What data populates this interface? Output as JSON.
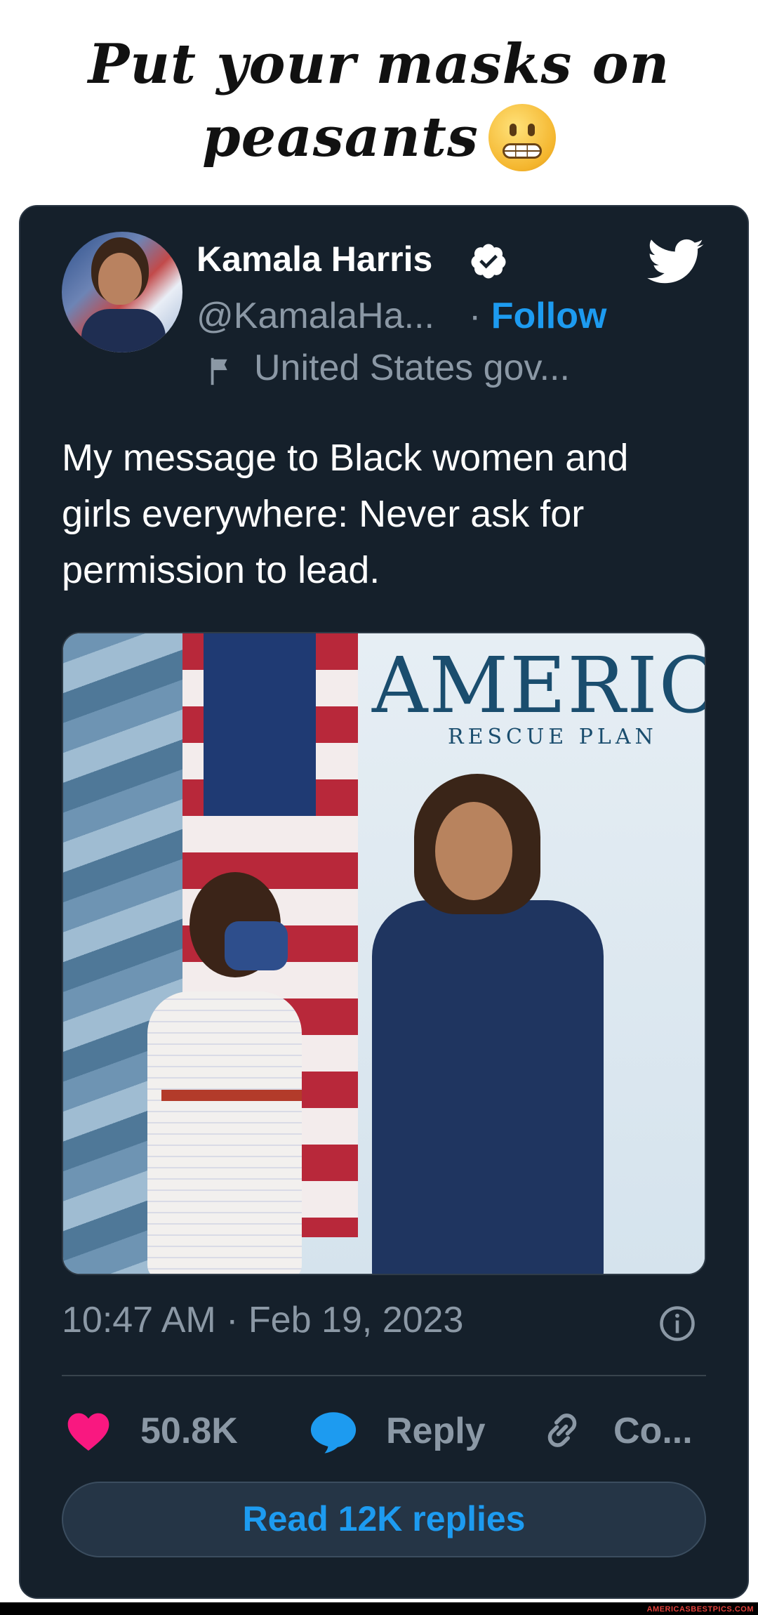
{
  "caption": {
    "line1": "Put your masks on",
    "line2": "peasants",
    "emoji": "grimacing-face"
  },
  "tweet": {
    "author_name": "Kamala Harris",
    "verified": true,
    "handle": "@KamalaHa...",
    "follow_separator": "·",
    "follow_label": "Follow",
    "affiliation": "United States gov...",
    "text": "My message to Black women and girls everywhere: Never ask for permission to lead.",
    "photo": {
      "banner_title": "AMERICAN",
      "banner_subtitle": "RESCUE PLAN"
    },
    "timestamp": "10:47 AM · Feb 19, 2023",
    "likes": "50.8K",
    "reply_label": "Reply",
    "copy_label": "Co...",
    "read_replies_label": "Read 12K replies"
  },
  "colors": {
    "card_bg": "#15202b",
    "accent": "#1d9bf0",
    "muted_text": "#8b98a5",
    "heart": "#f91880"
  },
  "footer": {
    "watermark": "AMERICASBESTPICS.COM"
  }
}
